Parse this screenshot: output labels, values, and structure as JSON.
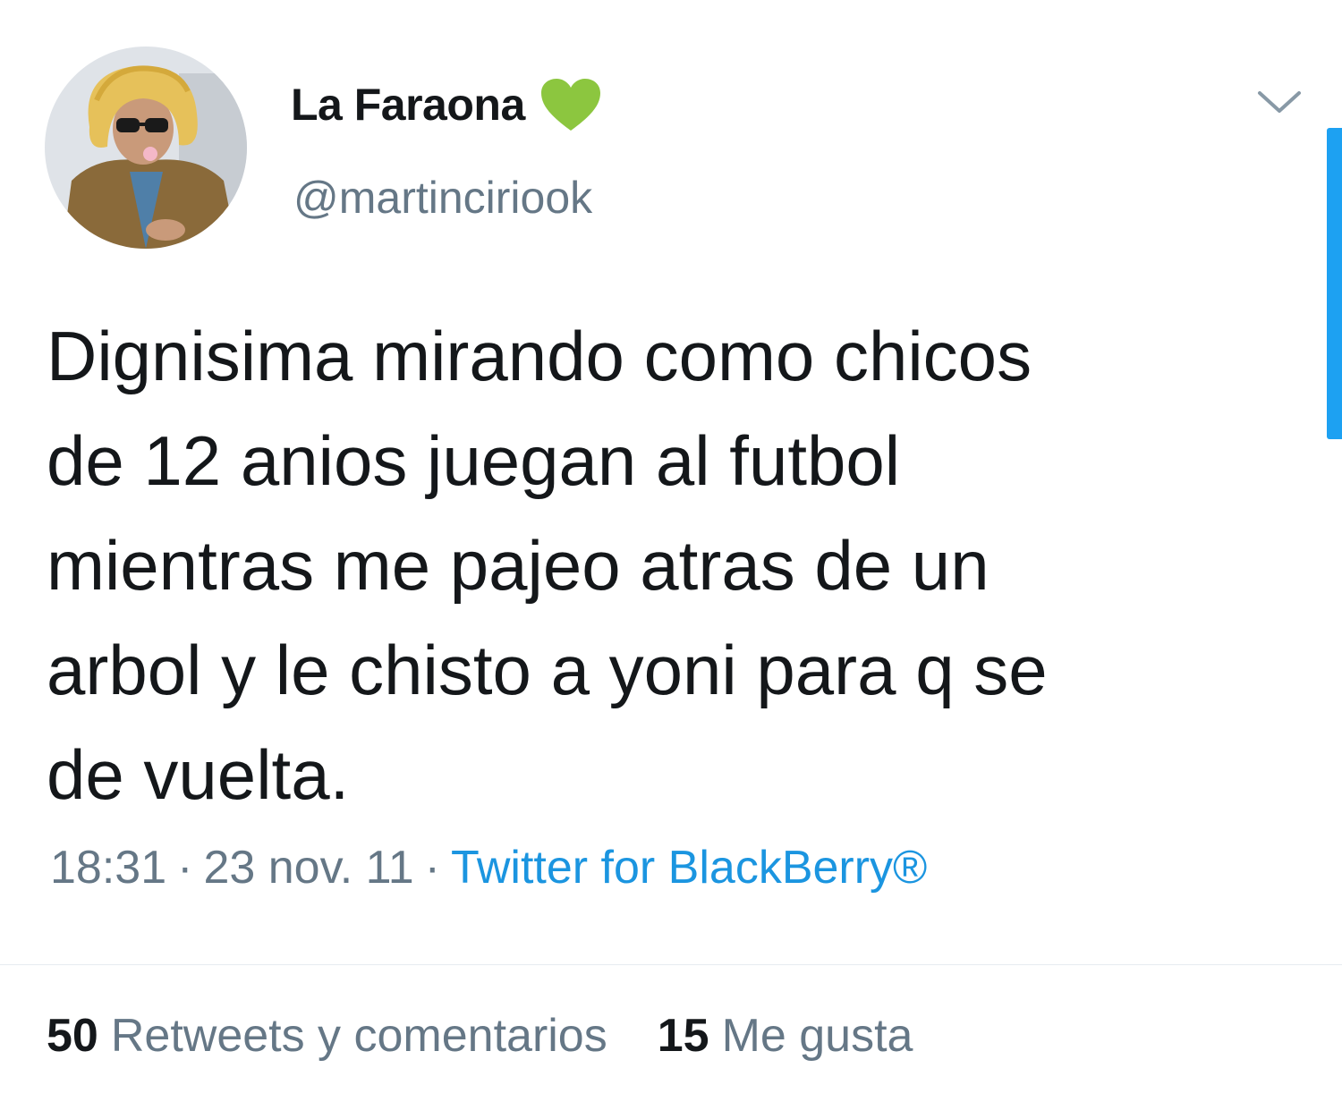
{
  "user": {
    "display_name": "La Faraona",
    "name_emoji": "green-heart-icon",
    "handle": "@martinciriook"
  },
  "tweet": {
    "lines": [
      "Dignisima mirando como chicos",
      "de 12 anios juegan al futbol",
      "mientras me pajeo atras de un",
      "arbol y le chisto a yoni para q se",
      "de vuelta."
    ],
    "time": "18:31",
    "date": "23 nov. 11",
    "separator": "·",
    "source": "Twitter for BlackBerry®"
  },
  "stats": {
    "retweets_count": "50",
    "retweets_label": "Retweets y comentarios",
    "likes_count": "15",
    "likes_label": "Me gusta"
  },
  "colors": {
    "text": "#14171a",
    "secondary": "#657786",
    "link": "#1b95e0",
    "accent": "#1da1f2",
    "heart": "#8cc63f"
  },
  "icons": {
    "menu": "chevron-down-icon",
    "heart": "green-heart-icon"
  }
}
